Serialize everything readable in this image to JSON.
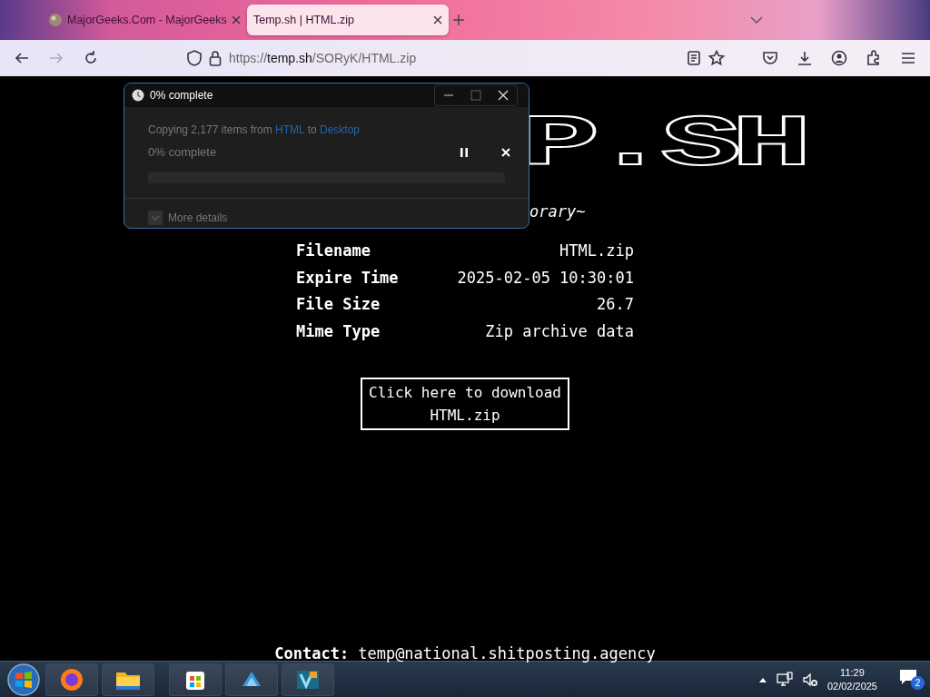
{
  "browser": {
    "tabs": [
      {
        "title": "MajorGeeks.Com - MajorGeeks",
        "selected": false
      },
      {
        "title": "Temp.sh | HTML.zip",
        "selected": true
      }
    ],
    "url": {
      "scheme": "https://",
      "domain": "temp.sh",
      "path": "/SORyK/HTML.zip"
    }
  },
  "page": {
    "logo": "P.SH",
    "tagline": "orary~",
    "details": [
      {
        "label": "Filename",
        "value": "HTML.zip"
      },
      {
        "label": "Expire Time",
        "value": "2025-02-05 10:30:01"
      },
      {
        "label": "File Size",
        "value": "26.7"
      },
      {
        "label": "Mime Type",
        "value": "Zip archive data"
      }
    ],
    "download_button": {
      "line_1": "Click here to download",
      "line_2": "HTML.zip"
    },
    "contact": {
      "label": "Contact:",
      "email": "temp@national.shitposting.agency"
    }
  },
  "copy_dialog": {
    "title": "0% complete",
    "status": {
      "text": "Copying 2,177 items from",
      "source": "HTML",
      "middle": "to",
      "destination": "Desktop"
    },
    "percent": "0% complete",
    "progress": {
      "level": 0
    },
    "more_details": "More details"
  },
  "taskbar": {
    "time": "11:29",
    "date": "02/02/2025",
    "notifications": "2"
  }
}
